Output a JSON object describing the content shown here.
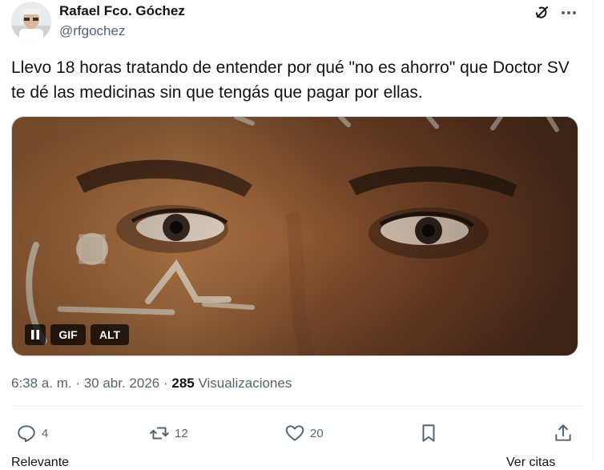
{
  "author": {
    "name": "Rafael Fco. Góchez",
    "handle": "@rfgochez"
  },
  "tweet": {
    "text": "Llevo 18 horas tratando de entender por qué \"no es ahorro\" que Doctor SV te dé las medicinas sin que tengás que pagar por ellas."
  },
  "media": {
    "gif_label": "GIF",
    "alt_label": "ALT"
  },
  "meta": {
    "time": "6:38 a. m.",
    "separator": " · ",
    "date": "30 abr. 2026",
    "views_count": "285",
    "views_label": "Visualizaciones"
  },
  "actions": {
    "replies": "4",
    "reposts": "12",
    "likes": "20"
  },
  "clipped": {
    "left": "Relevante",
    "right": "Ver citas"
  },
  "icons": {
    "grok": "grok-icon",
    "more": "more-icon",
    "reply": "reply-icon",
    "repost": "repost-icon",
    "like": "heart-icon",
    "bookmark": "bookmark-icon",
    "share": "share-icon",
    "pause": "pause-icon"
  },
  "colors": {
    "secondary_text": "#536471",
    "primary_text": "#0f1419",
    "divider": "#eff3f4"
  }
}
